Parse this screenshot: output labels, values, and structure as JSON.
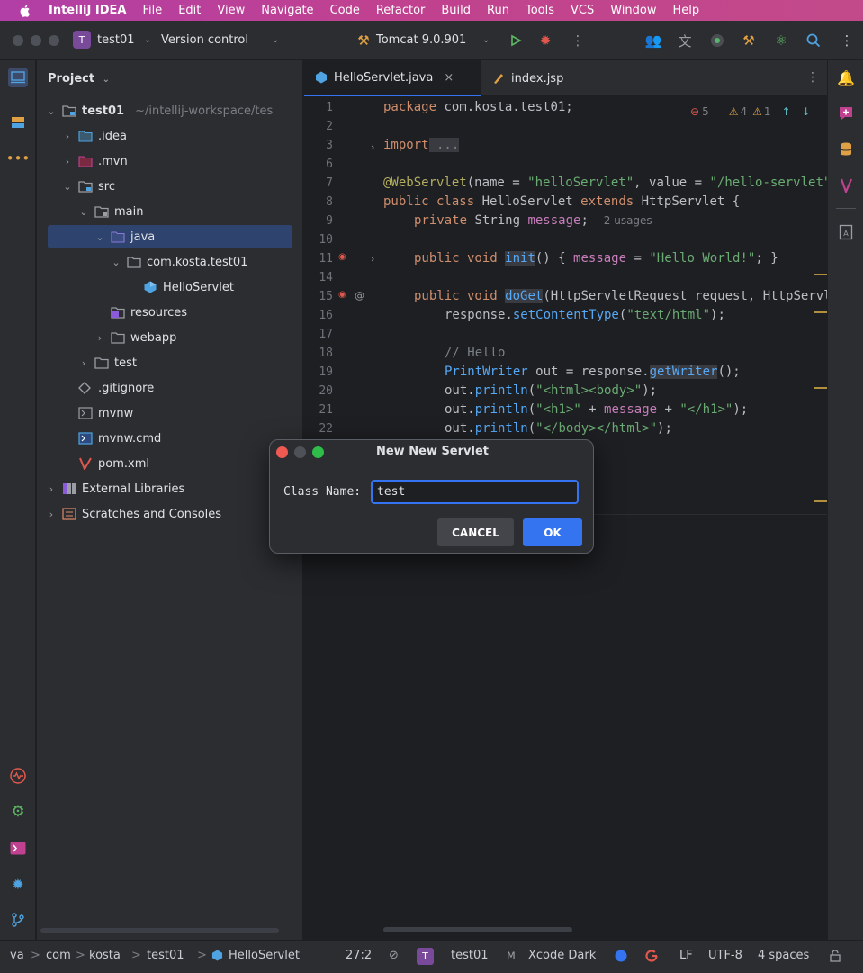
{
  "menubar": {
    "app_name": "IntelliJ IDEA",
    "items": [
      "File",
      "Edit",
      "View",
      "Navigate",
      "Code",
      "Refactor",
      "Build",
      "Run",
      "Tools",
      "VCS",
      "Window",
      "Help"
    ]
  },
  "toolbar": {
    "project_initial": "T",
    "project_name": "test01",
    "vcs_label": "Version control",
    "run_config": "Tomcat 9.0.901"
  },
  "project_panel": {
    "title": "Project",
    "tree": [
      {
        "label": "test01",
        "extra": "~/intellij-workspace/tes"
      },
      {
        "label": ".idea"
      },
      {
        "label": ".mvn"
      },
      {
        "label": "src"
      },
      {
        "label": "main"
      },
      {
        "label": "java"
      },
      {
        "label": "com.kosta.test01"
      },
      {
        "label": "HelloServlet"
      },
      {
        "label": "resources"
      },
      {
        "label": "webapp"
      },
      {
        "label": "test"
      },
      {
        "label": ".gitignore"
      },
      {
        "label": "mvnw"
      },
      {
        "label": "mvnw.cmd"
      },
      {
        "label": "pom.xml"
      },
      {
        "label": "External Libraries"
      },
      {
        "label": "Scratches and Consoles"
      }
    ]
  },
  "editor": {
    "tabs": [
      {
        "label": "HelloServlet.java",
        "close": "×"
      },
      {
        "label": "index.jsp"
      }
    ],
    "inspections": {
      "errors": "5",
      "warnings": "4",
      "weak_warnings": "1"
    },
    "line_numbers": [
      "1",
      "2",
      "3",
      "6",
      "7",
      "8",
      "9",
      "10",
      "11",
      "14",
      "15",
      "16",
      "17",
      "18",
      "19",
      "20",
      "21",
      "22"
    ],
    "code": {
      "l1_kw": "package",
      "l1_rest": " com.kosta.test01;",
      "l3_kw": "import",
      "l3_rest": " ...",
      "l7_ann": "@WebServlet",
      "l7_a": "(name = ",
      "l7_s1": "\"helloServlet\"",
      "l7_b": ", value = ",
      "l7_s2": "\"/hello-servlet\"",
      "l8_kw": "public class",
      "l8_a": " HelloServlet ",
      "l8_kw2": "extends",
      "l8_b": " HttpServlet {",
      "l9_kw": "private",
      "l9_a": " String ",
      "l9_f": "message",
      "l9_b": ";",
      "l9_hint": "2 usages",
      "l11_kw": "public void",
      "l11_m": "init",
      "l11_a": "() { ",
      "l11_f": "message",
      "l11_b": " = ",
      "l11_s": "\"Hello World!\"",
      "l11_c": "; }",
      "l15_kw": "public void",
      "l15_m": "doGet",
      "l15_a": "(HttpServletRequest request, HttpServl",
      "l16_a": "response.",
      "l16_m": "setContentType",
      "l16_b": "(",
      "l16_s": "\"text/html\"",
      "l16_c": ");",
      "l18_c": "// Hello",
      "l19_t": "PrintWriter",
      "l19_a": " out = response.",
      "l19_m": "getWriter",
      "l19_b": "();",
      "l20_a": "out.",
      "l20_m": "println",
      "l20_b": "(",
      "l20_s": "\"<html><body>\"",
      "l20_c": ");",
      "l21_a": "out.",
      "l21_m": "println",
      "l21_b": "(",
      "l21_s": "\"<h1>\"",
      "l21_c": " + ",
      "l21_f": "message",
      "l21_d": " + ",
      "l21_s2": "\"</h1>\"",
      "l21_e": ");",
      "l22_a": "out.",
      "l22_m": "println",
      "l22_b": "(",
      "l22_s": "\"</body></html>\"",
      "l22_c": ");"
    }
  },
  "dialog": {
    "title": "New New Servlet",
    "field_label": "Class Name:",
    "field_value": "test",
    "cancel_label": "CANCEL",
    "ok_label": "OK"
  },
  "statusbar": {
    "breadcrumb": [
      "va",
      "com",
      "kosta",
      "test01",
      "HelloServlet"
    ],
    "separator": ">",
    "position": "27:2",
    "project_initial": "T",
    "project": "test01",
    "theme": "Xcode Dark",
    "line_ending": "LF",
    "encoding": "UTF-8",
    "indent": "4 spaces"
  },
  "colors": {
    "accent": "#3574f0",
    "menubar": "#c0418f",
    "panel_bg": "#2b2d30",
    "editor_bg": "#1e1f22",
    "selection": "#2e436e"
  }
}
